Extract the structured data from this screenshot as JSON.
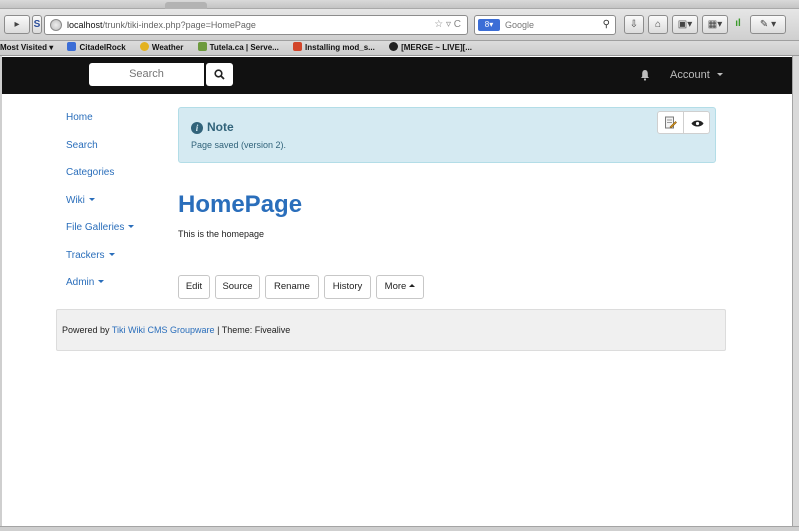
{
  "browser": {
    "url_host": "localhost",
    "url_path": "/trunk/tiki-index.php?page=HomePage",
    "search_engine_label": "Google",
    "bookmarks": [
      {
        "label": "Most Visited ▾",
        "color": ""
      },
      {
        "label": "CitadelRock",
        "color": "#3b6dd6"
      },
      {
        "label": "Weather",
        "color": "#e3b220"
      },
      {
        "label": "Tutela.ca | Serve...",
        "color": "#6d9a3d"
      },
      {
        "label": "Installing mod_s...",
        "color": "#d2452a"
      },
      {
        "label": "[MERGE ~ LIVE][...",
        "color": "#222222"
      }
    ]
  },
  "site_nav": {
    "search_placeholder": "Search",
    "account_label": "Account"
  },
  "sidebar": {
    "items": [
      {
        "label": "Home"
      },
      {
        "label": "Search"
      },
      {
        "label": "Categories"
      },
      {
        "label": "Wiki"
      },
      {
        "label": "File Galleries"
      },
      {
        "label": "Trackers"
      },
      {
        "label": "Admin"
      }
    ]
  },
  "note": {
    "title": "Note",
    "message": "Page saved (version 2)."
  },
  "page": {
    "title": "HomePage",
    "body": "This is the homepage"
  },
  "actions": {
    "edit": "Edit",
    "source": "Source",
    "rename": "Rename",
    "history": "History",
    "more": "More"
  },
  "footer": {
    "prefix": "Powered by ",
    "link": "Tiki Wiki CMS Groupware",
    "suffix": " | Theme: Fivealive"
  },
  "colors": {
    "link": "#2a6ebb",
    "navbar_bg": "#111111",
    "note_bg": "#d5eaf2"
  }
}
